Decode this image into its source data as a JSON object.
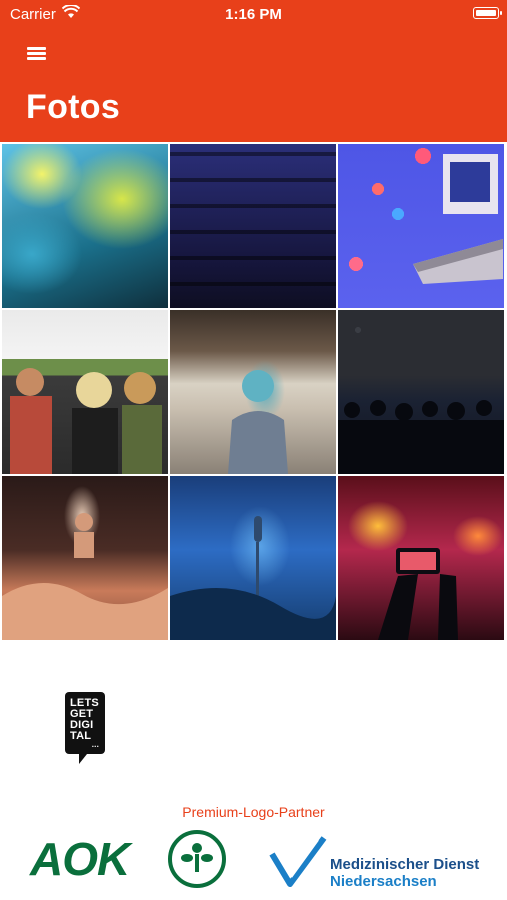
{
  "status_bar": {
    "carrier": "Carrier",
    "time": "1:16 PM"
  },
  "app_bar": {
    "title": "Fotos",
    "menu_icon": "hamburger-menu-icon"
  },
  "gallery": {
    "photos": [
      "colour-festival-crowd",
      "empty-conference-chairs",
      "virtual-event-stage-reactions",
      "outdoor-festival-audience",
      "speaker-in-lecture-hall",
      "seated-audience-dark-room",
      "concert-crowd-raised-hands",
      "singer-microphone-blue-light",
      "phone-filming-concert"
    ]
  },
  "sponsors": {
    "main_logo_text": "LETS GET DIGI TAL",
    "partner_label": "Premium-Logo-Partner",
    "aok_text": "AOK",
    "md_line1": "Medizinischer Dienst",
    "md_line2": "Niedersachsen"
  },
  "colors": {
    "accent": "#e8401a",
    "aok_green": "#0a6f3c",
    "md_blue": "#1b4f8a"
  }
}
